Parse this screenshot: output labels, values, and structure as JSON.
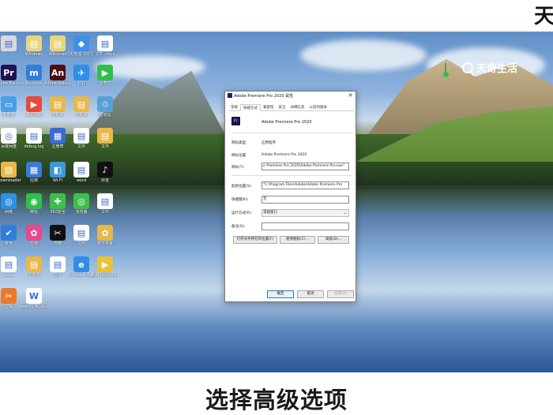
{
  "watermark": {
    "corner_text": "天",
    "brand": "天奇生活"
  },
  "desktop_icons": [
    {
      "label": "",
      "color": "#d9d9d9",
      "glyph": "▤"
    },
    {
      "label": "Windows",
      "color": "#e8d67a",
      "glyph": "▤"
    },
    {
      "label": "Windows",
      "color": "#e8d67a",
      "glyph": "▤"
    },
    {
      "label": "QQ影音 QQ 2.0",
      "color": "#3f8fe6",
      "glyph": "◆"
    },
    {
      "label": "文件 .docx",
      "color": "#ffffff",
      "glyph": "▤"
    },
    {
      "label": "Adobe Premiere",
      "color": "#1e1450",
      "glyph": "Pr"
    },
    {
      "label": "Maxthon",
      "color": "#2f7fd8",
      "glyph": "m"
    },
    {
      "label": "Adobe Animate",
      "color": "#4a0e12",
      "glyph": "An"
    },
    {
      "label": "钉钉",
      "color": "#2f8fe6",
      "glyph": "✈"
    },
    {
      "label": "爱奇艺",
      "color": "#2fbf4a",
      "glyph": "▶"
    },
    {
      "label": "此电脑",
      "color": "#4aa0e6",
      "glyph": "▭"
    },
    {
      "label": "腾讯视频",
      "color": "#e64a3a",
      "glyph": "▶"
    },
    {
      "label": "文件夹",
      "color": "#e8b84a",
      "glyph": "▤"
    },
    {
      "label": "文件夹",
      "color": "#e8b84a",
      "glyph": "▤"
    },
    {
      "label": "回收站",
      "color": "#5aa0d8",
      "glyph": "♲"
    },
    {
      "label": "百度网盘",
      "color": "#ffffff",
      "glyph": "◎"
    },
    {
      "label": "debug.log",
      "color": "#ffffff",
      "glyph": "▤"
    },
    {
      "label": "注册表",
      "color": "#3a6ad8",
      "glyph": "▦"
    },
    {
      "label": "文件",
      "color": "#ffffff",
      "glyph": "▤"
    },
    {
      "label": "文件",
      "color": "#e8b84a",
      "glyph": "▤"
    },
    {
      "label": "JDownloader",
      "color": "#e8b84a",
      "glyph": "▤"
    },
    {
      "label": "应用",
      "color": "#3a7ad8",
      "glyph": "▦"
    },
    {
      "label": "Wi-Fi",
      "color": "#3a9ad8",
      "glyph": "◧"
    },
    {
      "label": "word",
      "color": "#ffffff",
      "glyph": "▤"
    },
    {
      "label": "抖音",
      "color": "#111111",
      "glyph": "♪"
    },
    {
      "label": "网络",
      "color": "#2f8fe6",
      "glyph": "◎"
    },
    {
      "label": "微信",
      "color": "#2fbf4a",
      "glyph": "◉"
    },
    {
      "label": "360安全",
      "color": "#3fbf4a",
      "glyph": "✚"
    },
    {
      "label": "浏览器",
      "color": "#3fbf4a",
      "glyph": "◎"
    },
    {
      "label": "文件",
      "color": "#ffffff",
      "glyph": "▤"
    },
    {
      "label": "安全",
      "color": "#2f7fd8",
      "glyph": "✔"
    },
    {
      "label": "应用",
      "color": "#e64a8a",
      "glyph": "✿"
    },
    {
      "label": "剪映",
      "color": "#111111",
      "glyph": "✂"
    },
    {
      "label": "文件",
      "color": "#ffffff",
      "glyph": "▤"
    },
    {
      "label": "软件管家",
      "color": "#e8b84a",
      "glyph": "✿"
    },
    {
      "label": "video",
      "color": "#ffffff",
      "glyph": "▤"
    },
    {
      "label": "文件夹",
      "color": "#e8b84a",
      "glyph": "▤"
    },
    {
      "label": "文件",
      "color": "#ffffff",
      "glyph": "▤"
    },
    {
      "label": "Microsoft Edge",
      "color": "#2f8fe6",
      "glyph": "e"
    },
    {
      "label": "PotPlayer 64 bit",
      "color": "#e8c23a",
      "glyph": "▶"
    },
    {
      "label": "剪辑",
      "color": "#e87a2a",
      "glyph": "✂"
    },
    {
      "label": "word文档 .docx",
      "color": "#ffffff",
      "glyph": "W"
    }
  ],
  "dialog": {
    "title": "Adobe Premiere Pro 2020 属性",
    "close_glyph": "✕",
    "tabs": [
      "常规",
      "快捷方式",
      "兼容性",
      "安全",
      "详细信息",
      "以前的版本"
    ],
    "active_tab": "快捷方式",
    "program_icon_text": "Pr",
    "program_name": "Adobe Premiere Pro 2020",
    "target_type_label": "目标类型:",
    "target_type_value": "应用程序",
    "target_location_label": "目标位置:",
    "target_location_value": "Adobe Premiere Pro 2020",
    "target_label": "目标(T):",
    "target_value": "e Premiere Pro 2020\\Adobe Premiere Pro.exe\"",
    "start_in_label": "起始位置(S):",
    "start_in_value": "\"C:\\Program Files\\Adobe\\Adobe Premiere Pro",
    "shortcut_key_label": "快捷键(K):",
    "shortcut_key_value": "无",
    "run_label": "运行方式(R):",
    "run_value": "常规窗口",
    "comment_label": "备注(O):",
    "comment_value": "",
    "open_location_button": "打开文件所在的位置(F)",
    "change_icon_button": "更改图标(C)...",
    "advanced_button": "高级(D)...",
    "ok_button": "确定",
    "cancel_button": "取消",
    "apply_button": "应用(A)"
  },
  "caption": "选择高级选项"
}
